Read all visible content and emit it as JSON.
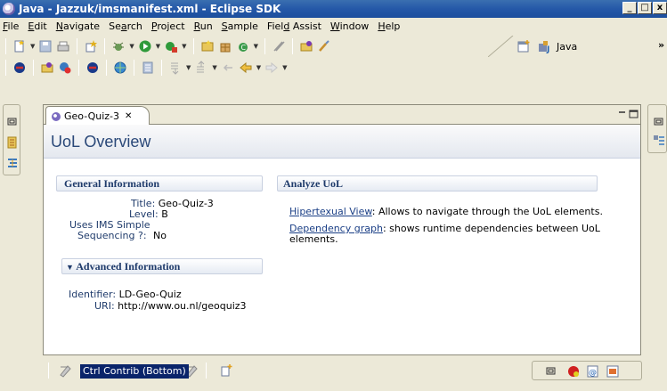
{
  "window": {
    "title": "Java - Jazzuk/imsmanifest.xml - Eclipse SDK",
    "minimize": "_",
    "restore": "□",
    "close": "x"
  },
  "menu": [
    "File",
    "Edit",
    "Navigate",
    "Search",
    "Project",
    "Run",
    "Sample",
    "Field Assist",
    "Window",
    "Help"
  ],
  "menu_mnemonics": [
    "F",
    "E",
    "N",
    "a",
    "P",
    "R",
    "S",
    "d",
    "W",
    "H"
  ],
  "perspective": {
    "label": "Java",
    "overflow": "»"
  },
  "editor": {
    "tab_label": "Geo-Quiz-3",
    "tab_close": "✕",
    "header_title": "UoL Overview",
    "general": {
      "heading": "General Information",
      "title_label": "Title:",
      "title_value": "Geo-Quiz-3",
      "level_label": "Level:",
      "level_value": "B",
      "uses_label": "Uses IMS Simple",
      "sequencing_label": "Sequencing ?:",
      "sequencing_value": "No"
    },
    "advanced": {
      "heading": "Advanced Information",
      "identifier_label": "Identifier:",
      "identifier_value": "LD-Geo-Quiz",
      "uri_label": "URI:",
      "uri_value": "http://www.ou.nl/geoquiz3"
    },
    "analyze": {
      "heading": "Analyze UoL",
      "link1": "Hipertexual View",
      "link1_desc": ": Allows to navigate through the UoL elements.",
      "link2": "Dependency graph",
      "link2_desc": ": shows runtime dependencies between UoL",
      "link2_desc2": "elements."
    }
  },
  "status": {
    "ctrl_label": "Ctrl Contrib (Bottom)"
  },
  "colors": {
    "titlebar": "#1d4f9d",
    "header_text": "#2a4878",
    "link": "#1b3f86",
    "selection": "#0a246a"
  }
}
